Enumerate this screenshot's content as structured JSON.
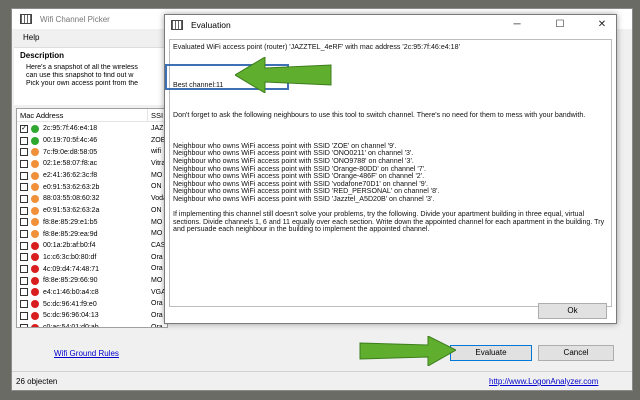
{
  "main_window": {
    "title": "Wifi Channel Picker",
    "menu": [
      "Help"
    ],
    "description_heading": "Description",
    "description_lines": [
      "Here's a snapshot of all the wireless",
      "can use this snapshot to find out w",
      "Pick your own access point from the"
    ],
    "list": {
      "col_mac": "Mac Address",
      "col_ssid": "SSI",
      "rows": [
        {
          "checked": true,
          "status": "green",
          "mac": "2c:95:7f:46:e4:18",
          "ssid": "JAZ"
        },
        {
          "checked": false,
          "status": "green",
          "mac": "00:19:70:5f:4c:46",
          "ssid": "ZOE"
        },
        {
          "checked": false,
          "status": "orange",
          "mac": "7c:f9:0e:d8:58:05",
          "ssid": "wifi"
        },
        {
          "checked": false,
          "status": "orange",
          "mac": "02:1e:58:07:f8:ac",
          "ssid": "Vitra"
        },
        {
          "checked": false,
          "status": "orange",
          "mac": "e2:41:36:62:3c:f8",
          "ssid": "MO"
        },
        {
          "checked": false,
          "status": "orange",
          "mac": "e0:91:53:62:63:2b",
          "ssid": "ON"
        },
        {
          "checked": false,
          "status": "orange",
          "mac": "88:03:55:08:60:32",
          "ssid": "Voda"
        },
        {
          "checked": false,
          "status": "orange",
          "mac": "e0:91:53:62:63:2a",
          "ssid": "ON"
        },
        {
          "checked": false,
          "status": "orange",
          "mac": "f8:8e:85:29:e1:b5",
          "ssid": "MO"
        },
        {
          "checked": false,
          "status": "orange",
          "mac": "f8:8e:85:29:ea:9d",
          "ssid": "MO"
        },
        {
          "checked": false,
          "status": "red",
          "mac": "00:1a:2b:af:b0:f4",
          "ssid": "CAS"
        },
        {
          "checked": false,
          "status": "red",
          "mac": "1c:c6:3c:b0:80:df",
          "ssid": "Ora"
        },
        {
          "checked": false,
          "status": "red",
          "mac": "4c:09:d4:74:48:71",
          "ssid": "Ora"
        },
        {
          "checked": false,
          "status": "red",
          "mac": "f8:8e:85:29:66:90",
          "ssid": "MO"
        },
        {
          "checked": false,
          "status": "red",
          "mac": "e4:c1:46:b0:a4:c8",
          "ssid": "VGA"
        },
        {
          "checked": false,
          "status": "red",
          "mac": "5c:dc:96:41:f9:e0",
          "ssid": "Ora"
        },
        {
          "checked": false,
          "status": "red",
          "mac": "5c:dc:96:96:04:13",
          "ssid": "Ora"
        },
        {
          "checked": false,
          "status": "red",
          "mac": "c0:ac:54:01:d0:ab",
          "ssid": "Ora"
        },
        {
          "checked": false,
          "status": "red",
          "mac": "f8:8e:85:41:59:47",
          "ssid": "Ora"
        }
      ]
    },
    "link_ground_rules": "Wifi Ground Rules",
    "evaluate_label": "Evaluate",
    "cancel_label": "Cancel",
    "status_count": "26 objecten",
    "status_link": "http://www.LogonAnalyzer.com"
  },
  "dialog": {
    "title": "Evaluation",
    "text": "Evaluated WiFi access point (router) 'JAZZTEL_4eRF' with mac address '2c:95:7f:46:e4:18'\n\n\n\n\nBest channel:11\n\n\n\nDon't forget to ask the following neighbours to use this tool to switch channel. There's no need for them to mess with your bandwith.\n\n\n\nNeighbour who owns WiFi access point with SSID 'ZOE' on channel '9'.\nNeighbour who owns WiFi access point with SSID 'ONO0211' on channel '3'.\nNeighbour who owns WiFi access point with SSID 'ONO9788' on channel '3'.\nNeighbour who owns WiFi access point with SSID 'Orange-80DD' on channel '7'.\nNeighbour who owns WiFi access point with SSID 'Orange-486F' on channel '2'.\nNeighbour who owns WiFi access point with SSID 'vodafone70D1' on channel '9'.\nNeighbour who owns WiFi access point with SSID 'RED_PERSONAL' on channel '8'.\nNeighbour who owns WiFi access point with SSID 'Jazztel_A5D20B' on channel '3'.\n\nIf implementing this channel still doesn't solve your problems, try the following. Divide your apartment building in three equal, virtual sections. Divide channels 1, 6 and 11 equally over each section. Write down the appointed channel for each apartment in the building. Try and persuade each neighbour in the building to implement the appointed channel.",
    "ok_label": "Ok",
    "help_glyph": "?",
    "close_glyph": "✕",
    "minimize_glyph": "─",
    "maximize_glyph": "☐"
  },
  "colors": {
    "green": "#2ea82e",
    "orange": "#f0913a",
    "red": "#d81e1e",
    "arrow": "#5fae2e",
    "highlight": "#3f6fb5"
  },
  "icons": [
    "checkbox-icon",
    "wifi-status-dot-icon",
    "close-icon",
    "help-icon",
    "minimize-icon",
    "maximize-icon",
    "arrow-icon",
    "app-icon"
  ]
}
